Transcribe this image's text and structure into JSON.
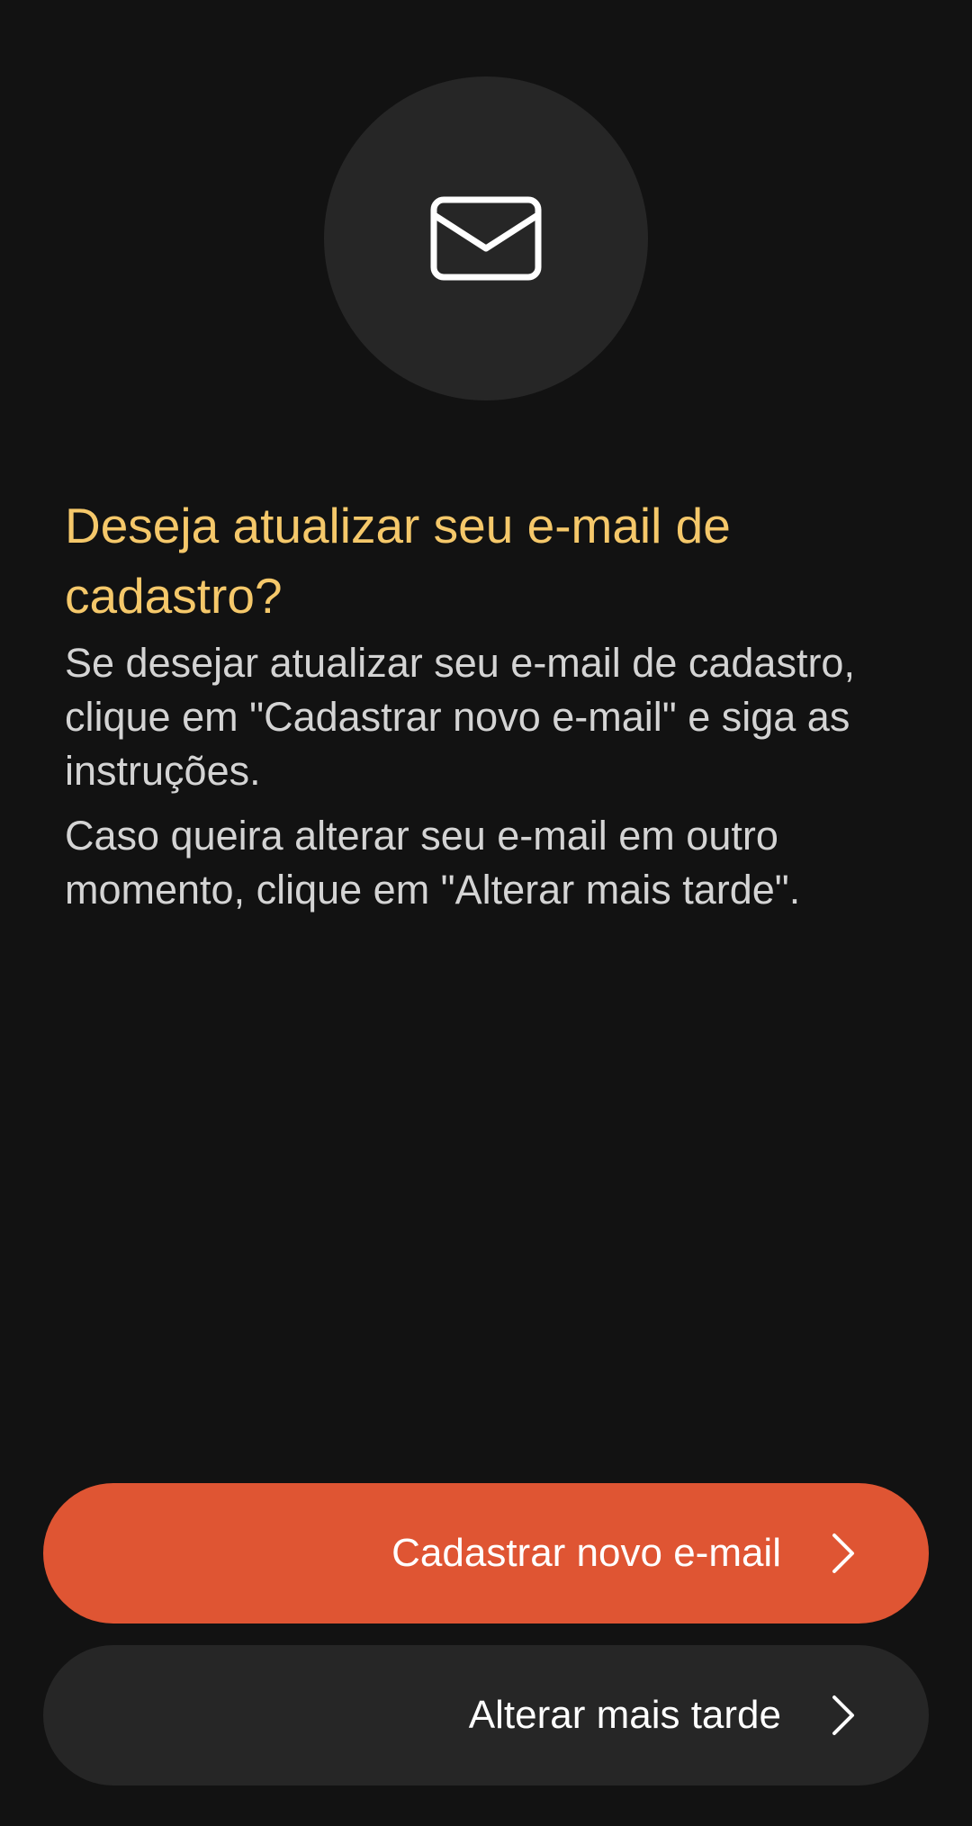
{
  "hero": {
    "icon": "envelope-icon"
  },
  "message": {
    "title": "Deseja atualizar seu e-mail de cadastro?",
    "paragraph1": "Se desejar atualizar seu e-mail de cadastro, clique em \"Cadastrar novo e-mail\" e siga as instruções.",
    "paragraph2": "Caso queira alterar seu e-mail em outro momento, clique em \"Alterar mais tarde\"."
  },
  "actions": {
    "primary_label": "Cadastrar novo e-mail",
    "secondary_label": "Alterar mais tarde"
  },
  "colors": {
    "background": "#121212",
    "title": "#f5c86a",
    "text": "#d4d4d4",
    "primary_button": "#df5533",
    "secondary_button": "#262626",
    "icon_circle": "#262626"
  }
}
